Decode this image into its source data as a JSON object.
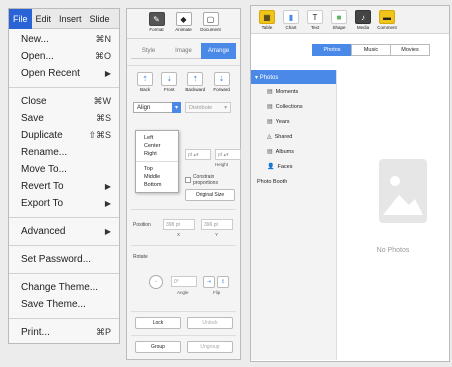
{
  "menubar": {
    "items": [
      "File",
      "Edit",
      "Insert",
      "Slide"
    ]
  },
  "file_menu": {
    "items": [
      {
        "label": "New...",
        "shortcut": "⌘N"
      },
      {
        "label": "Open...",
        "shortcut": "⌘O"
      },
      {
        "label": "Open Recent",
        "arrow": "▶"
      },
      {
        "label": "Close",
        "shortcut": "⌘W"
      },
      {
        "label": "Save",
        "shortcut": "⌘S"
      },
      {
        "label": "Duplicate",
        "shortcut": "⇧⌘S"
      },
      {
        "label": "Rename..."
      },
      {
        "label": "Move To..."
      },
      {
        "label": "Revert To",
        "arrow": "▶"
      },
      {
        "label": "Export To",
        "arrow": "▶"
      },
      {
        "label": "Advanced",
        "arrow": "▶"
      },
      {
        "label": "Set Password..."
      },
      {
        "label": "Change Theme..."
      },
      {
        "label": "Save Theme..."
      },
      {
        "label": "Print...",
        "shortcut": "⌘P"
      }
    ]
  },
  "inspector": {
    "toolbar": [
      {
        "icon": "paintbrush-icon",
        "glyph": "✎",
        "label": "Format"
      },
      {
        "icon": "animate-icon",
        "glyph": "◆",
        "label": "Animate"
      },
      {
        "icon": "document-icon",
        "glyph": "▢",
        "label": "Document"
      }
    ],
    "tabs": [
      "Style",
      "Image",
      "Arrange"
    ],
    "active_tab": "Arrange",
    "arrange_buttons": [
      {
        "glyph": "⇡",
        "label": "Back"
      },
      {
        "glyph": "⇣",
        "label": "Front"
      },
      {
        "glyph": "⇡",
        "label": "Backward"
      },
      {
        "glyph": "⇣",
        "label": "Forward"
      }
    ],
    "align_select": "Align",
    "distribute_select": "Distribute",
    "align_options": [
      "Left",
      "Center",
      "Right",
      "Top",
      "Middle",
      "Bottom"
    ],
    "height_label": "Height",
    "constrain_label": "Constrain proportions",
    "original_size": "Original Size",
    "position_label": "Position",
    "x_label": "X",
    "y_label": "Y",
    "x_value": "398 pt",
    "y_value": "396 pt",
    "rotate_label": "Rotate",
    "angle_value": "0°",
    "angle_label": "Angle",
    "flip_label": "Flip",
    "lock_button": "Lock",
    "unlock_button": "Unlock",
    "group_button": "Group",
    "ungroup_button": "Ungroup"
  },
  "media_browser": {
    "toolbar": [
      {
        "icon": "table-icon",
        "glyph": "▦",
        "label": "Table",
        "color": "#f0c419"
      },
      {
        "icon": "chart-icon",
        "glyph": "▮",
        "label": "Chart",
        "color": "#4a89e8"
      },
      {
        "icon": "text-icon",
        "glyph": "T",
        "label": "Text",
        "color": "#444444"
      },
      {
        "icon": "shape-icon",
        "glyph": "■",
        "label": "Shape",
        "color": "#5cb85c"
      },
      {
        "icon": "media-icon",
        "glyph": "♪",
        "label": "Media",
        "color": "#ffffff"
      },
      {
        "icon": "comment-icon",
        "glyph": "▬",
        "label": "Comment",
        "color": "#f0c419"
      }
    ],
    "segments": [
      "Photos",
      "Music",
      "Movies"
    ],
    "active_segment": "Photos",
    "sidebar_header": "▾ Photos",
    "sidebar_items": [
      {
        "icon": "moments-icon",
        "glyph": "▤",
        "label": "Moments"
      },
      {
        "icon": "collections-icon",
        "glyph": "▤",
        "label": "Collections"
      },
      {
        "icon": "years-icon",
        "glyph": "▤",
        "label": "Years"
      },
      {
        "icon": "shared-icon",
        "glyph": "◬",
        "label": "Shared"
      },
      {
        "icon": "albums-icon",
        "glyph": "▤",
        "label": "Albums"
      },
      {
        "icon": "faces-icon",
        "glyph": "👤",
        "label": "Faces"
      }
    ],
    "photo_booth": "Photo Booth",
    "empty_label": "No Photos"
  }
}
